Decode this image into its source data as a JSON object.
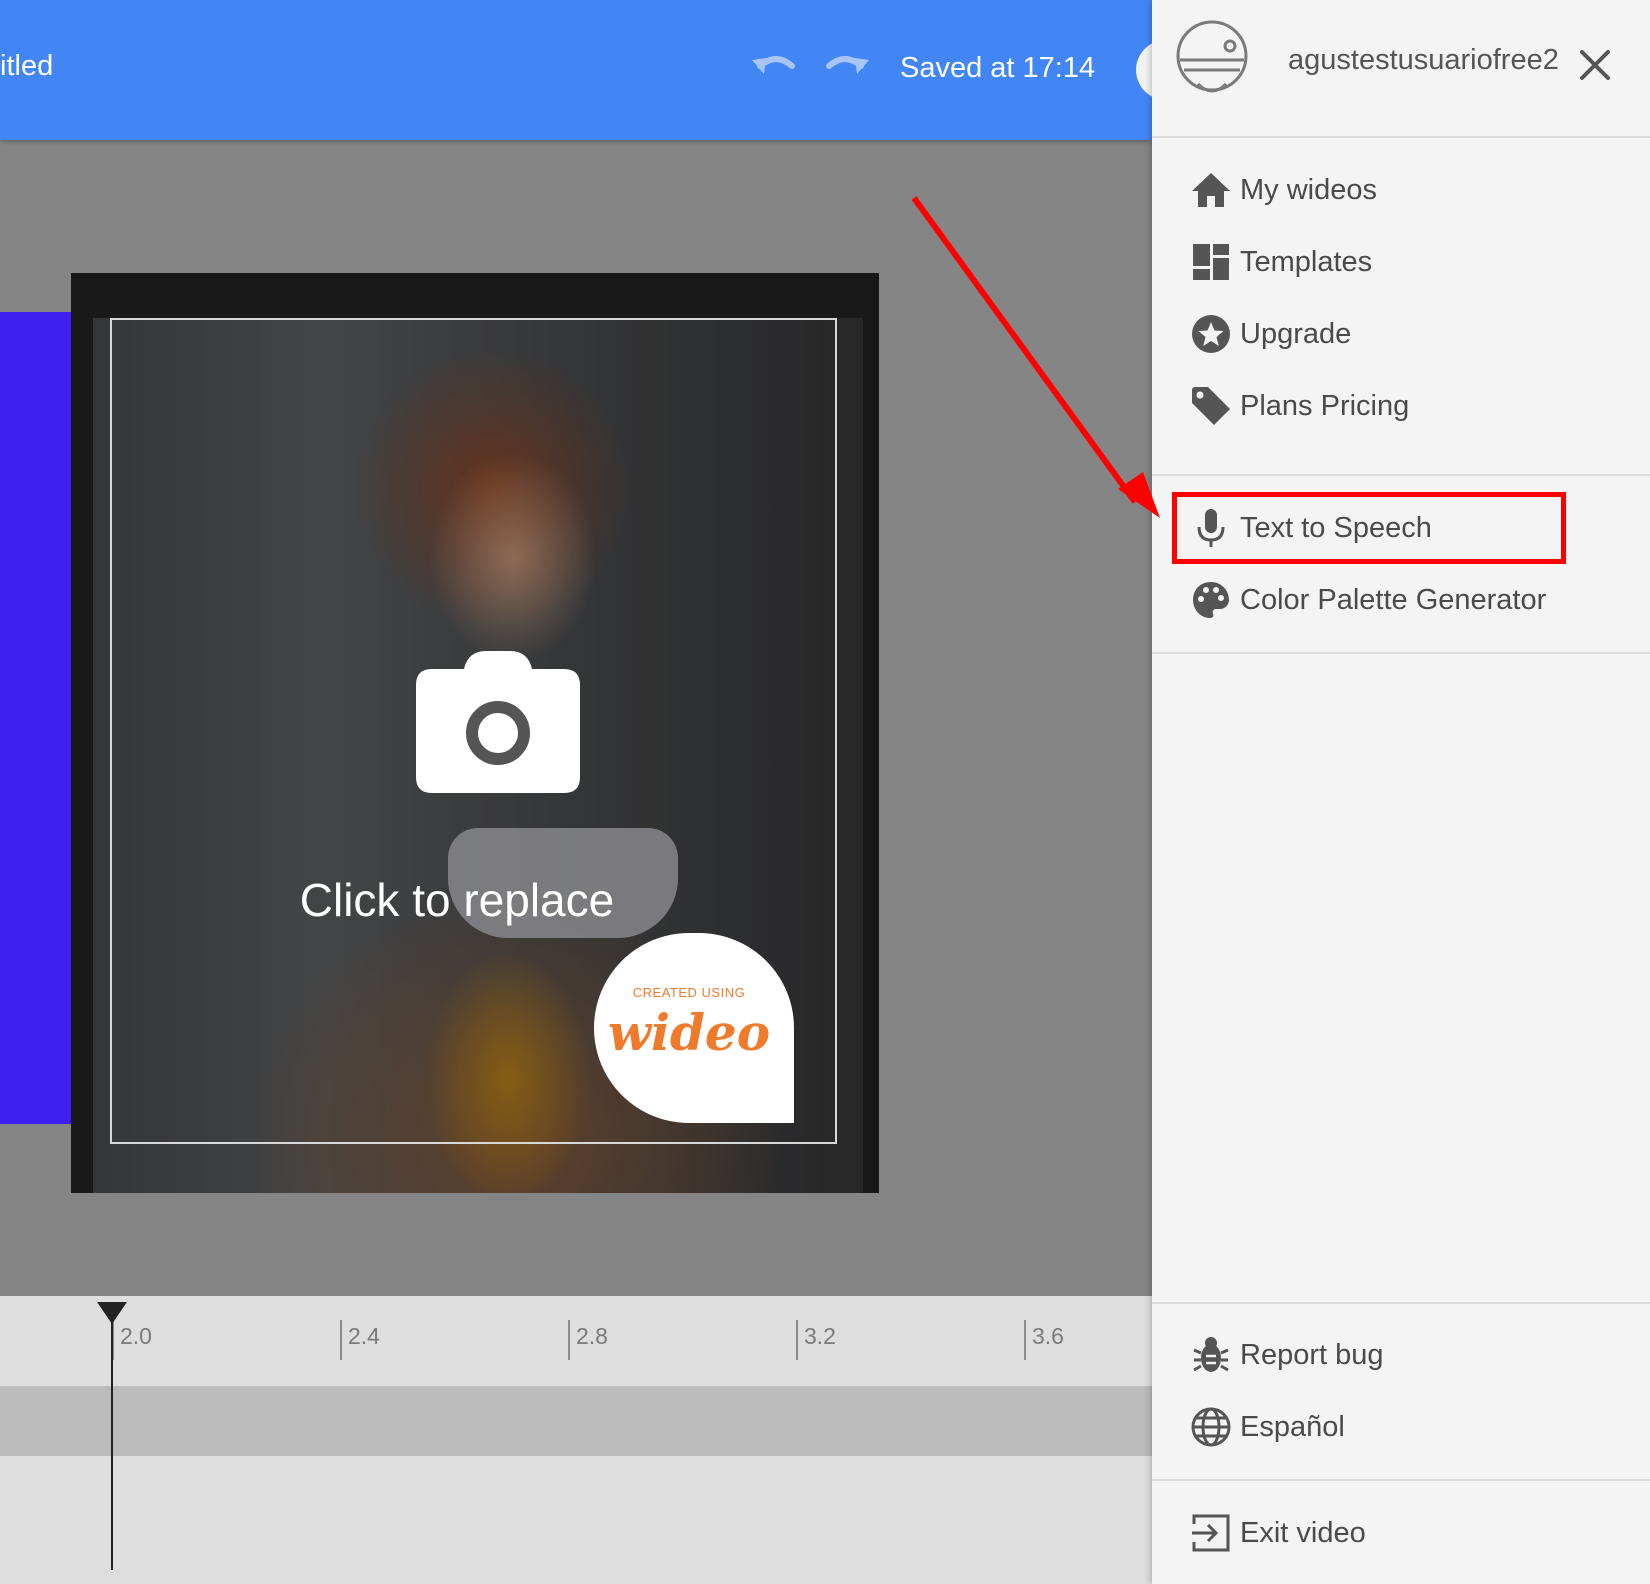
{
  "header": {
    "title": "itled",
    "saved_status": "Saved at 17:14",
    "undo_icon": "undo-icon",
    "redo_icon": "redo-icon"
  },
  "canvas": {
    "replace_label": "Click to replace",
    "camera_icon": "camera-icon",
    "watermark_small": "CREATED USING",
    "watermark_logo": "wideo",
    "shape_color": "#3f1ff2"
  },
  "timeline": {
    "ticks": [
      "2.0",
      "2.4",
      "2.8",
      "3.2",
      "3.6"
    ]
  },
  "sidebar": {
    "username": "agustestusuariofree2",
    "groups": [
      [
        {
          "label": "My wideos",
          "icon": "home-icon"
        },
        {
          "label": "Templates",
          "icon": "templates-icon"
        },
        {
          "label": "Upgrade",
          "icon": "star-icon"
        },
        {
          "label": "Plans Pricing",
          "icon": "tag-icon"
        }
      ],
      [
        {
          "label": "Text to Speech",
          "icon": "microphone-icon"
        },
        {
          "label": "Color Palette Generator",
          "icon": "palette-icon"
        }
      ],
      [
        {
          "label": "Report bug",
          "icon": "bug-icon"
        },
        {
          "label": "Español",
          "icon": "globe-icon"
        }
      ],
      [
        {
          "label": "Exit video",
          "icon": "exit-icon"
        }
      ]
    ]
  },
  "colors": {
    "header": "#4286f5",
    "annotation": "#ff0000"
  }
}
